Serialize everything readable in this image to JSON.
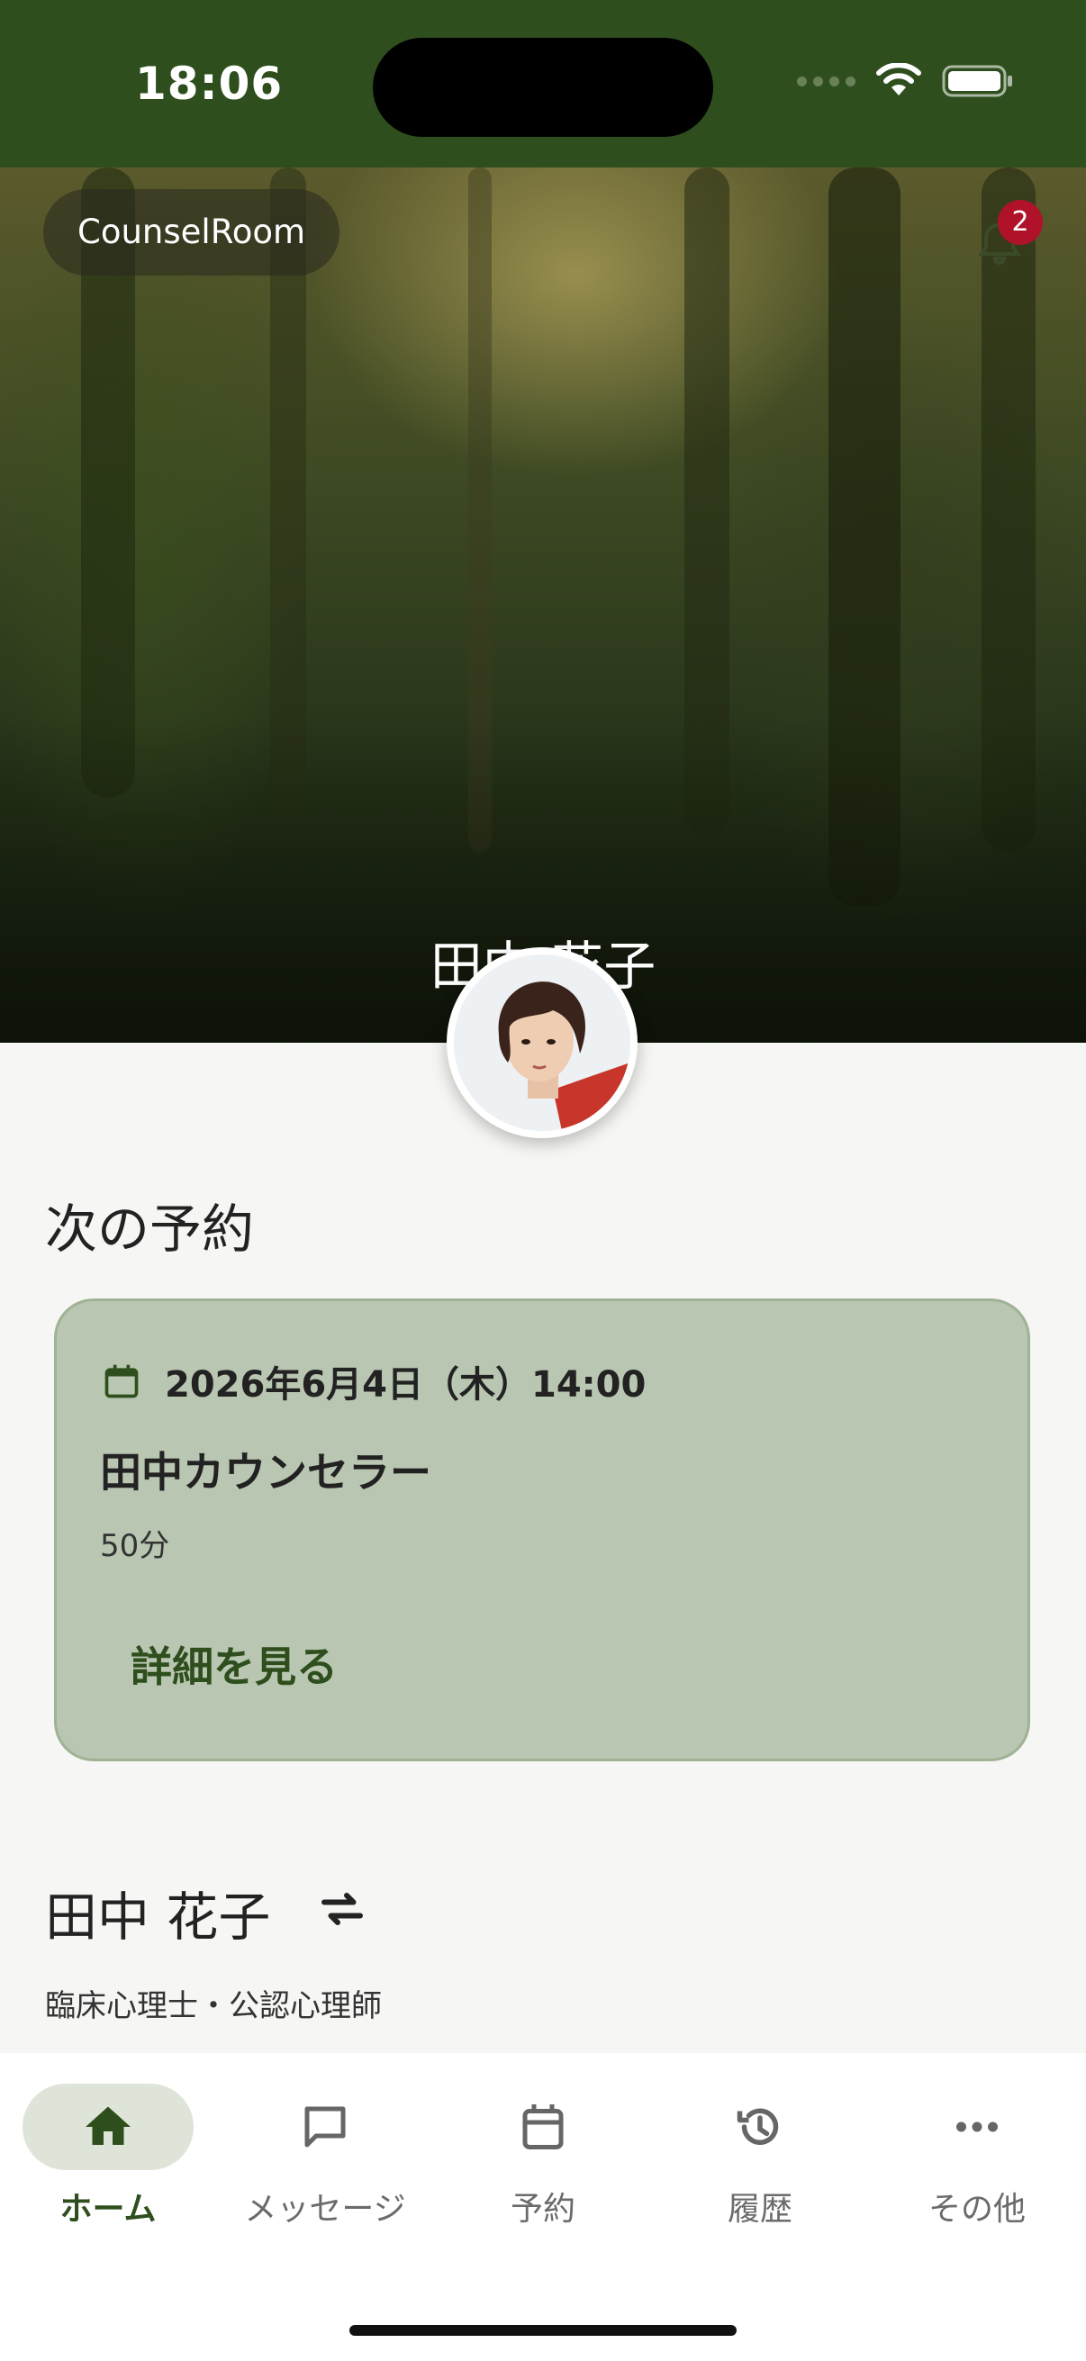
{
  "status_bar": {
    "time": "18:06"
  },
  "app": {
    "name": "CounselRoom",
    "notification_count": "2"
  },
  "hero": {
    "client_name": "田中 花子"
  },
  "next_appointment": {
    "section_title": "次の予約",
    "datetime": "2026年6月4日（木）14:00",
    "counselor": "田中カウンセラー",
    "duration": "50分",
    "details_link": "詳細を見る"
  },
  "profile": {
    "name": "田中 花子",
    "title": "臨床心理士・公認心理師"
  },
  "bottom_nav": {
    "items": [
      {
        "label": "ホーム",
        "icon": "home-icon",
        "active": true
      },
      {
        "label": "メッセージ",
        "icon": "message-icon",
        "active": false
      },
      {
        "label": "予約",
        "icon": "calendar-icon",
        "active": false
      },
      {
        "label": "履歴",
        "icon": "history-icon",
        "active": false
      },
      {
        "label": "その他",
        "icon": "more-icon",
        "active": false
      }
    ]
  },
  "colors": {
    "brand": "#2e4f1d",
    "card_bg": "#b9c6b1",
    "badge": "#b0122a",
    "nav_active_bg": "#dfe4d8"
  }
}
